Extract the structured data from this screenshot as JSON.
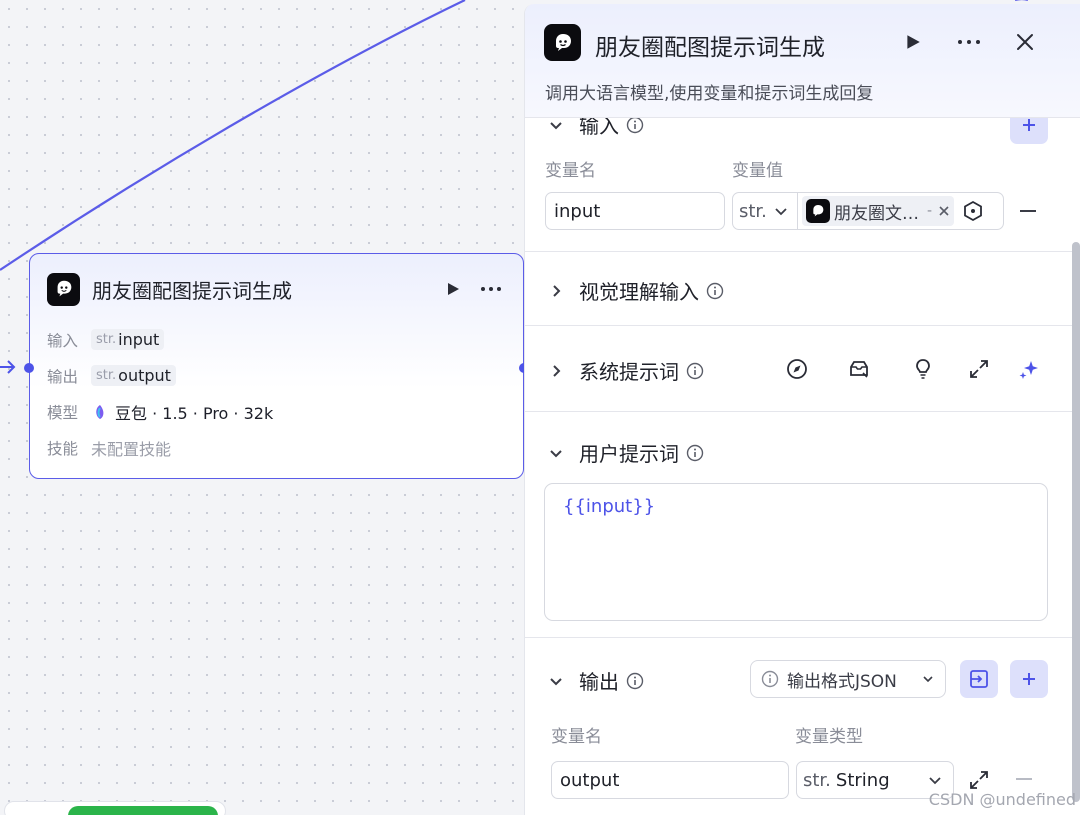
{
  "node": {
    "title": "朋友圈配图提示词生成",
    "input_label": "输入",
    "input_type": "str.",
    "input_value": "input",
    "output_label": "输出",
    "output_type": "str.",
    "output_value": "output",
    "model_label": "模型",
    "model_value": "豆包 · 1.5 · Pro · 32k",
    "skill_label": "技能",
    "skill_value": "未配置技能"
  },
  "panel": {
    "title": "朋友圈配图提示词生成",
    "description": "调用大语言模型,使用变量和提示词生成回复",
    "input_section": {
      "title": "输入",
      "col_name": "变量名",
      "col_value": "变量值",
      "var_name": "input",
      "type_select": "str.",
      "ref_chip": "朋友圈文…",
      "ref_suffix": "-"
    },
    "vision_section": {
      "title": "视觉理解输入"
    },
    "system_section": {
      "title": "系统提示词"
    },
    "user_section": {
      "title": "用户提示词",
      "content": "{{input}}"
    },
    "output_section": {
      "title": "输出",
      "format_button": "输出格式JSON",
      "col_name": "变量名",
      "col_type": "变量类型",
      "var_name": "output",
      "type_prefix": "str.",
      "type_value": "String"
    }
  },
  "watermark": "CSDN @undefined",
  "colors": {
    "accent": "#4d53e8",
    "accent_light": "#dde0fb",
    "green": "#2bb44a"
  }
}
